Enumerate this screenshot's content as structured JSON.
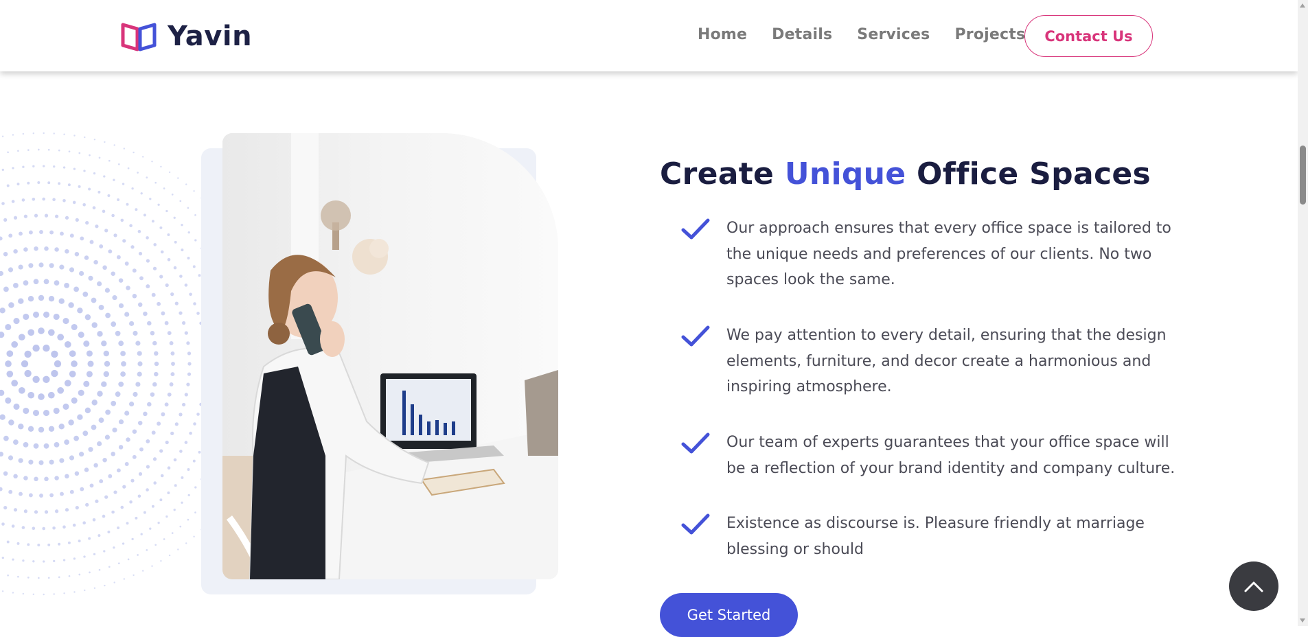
{
  "header": {
    "logo_text": "Yavin",
    "nav": [
      "Home",
      "Details",
      "Services",
      "Projects"
    ],
    "contact_label": "Contact Us"
  },
  "colors": {
    "accent_blue": "#4452d8",
    "brand_pink": "#d8347a",
    "heading_dark": "#1a1d40",
    "dots": "#b8c0ec"
  },
  "section": {
    "heading_part1": "Create ",
    "heading_accent": "Unique",
    "heading_part2": " Office Spaces",
    "features": [
      "Our approach ensures that every office space is tailored to the unique needs and preferences of our clients. No two spaces look the same.",
      "We pay attention to every detail, ensuring that the design elements, furniture, and decor create a harmonious and inspiring atmosphere.",
      "Our team of experts guarantees that your office space will be a reflection of your brand identity and company culture.",
      "Existence as discourse is. Pleasure friendly at marriage blessing or should"
    ],
    "cta_label": "Get Started"
  },
  "icons": {
    "logo": "open-book-logo-icon",
    "check": "checkmark-icon",
    "scroll_top": "chevron-up-icon"
  }
}
